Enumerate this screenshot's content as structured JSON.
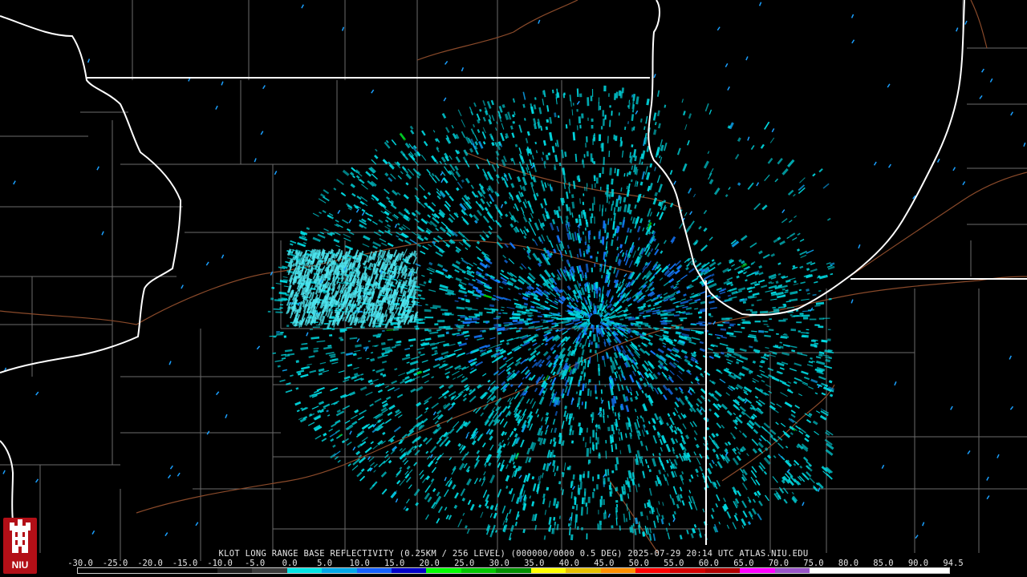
{
  "caption": "KLOT LONG RANGE BASE REFLECTIVITY (0.25KM / 256 LEVEL) (000000/0000 0.5 DEG) 2025-07-29 20:14 UTC  ATLAS.NIU.EDU",
  "logo_text": "NIU",
  "scale": {
    "labels": [
      "-30.0",
      "-25.0",
      "-20.0",
      "-15.0",
      "-10.0",
      "-5.0",
      "0.0",
      "5.0",
      "10.0",
      "15.0",
      "20.0",
      "25.0",
      "30.0",
      "35.0",
      "40.0",
      "45.0",
      "50.0",
      "55.0",
      "60.0",
      "65.0",
      "70.0",
      "75.0",
      "80.0",
      "85.0",
      "90.0",
      "94.5"
    ],
    "colors": [
      "#000000",
      "#000000",
      "#000000",
      "#000000",
      "#1e1e1e",
      "#3b3b3b",
      "#00e5e5",
      "#00a8e8",
      "#1460ff",
      "#0000c8",
      "#00ff00",
      "#00c800",
      "#009000",
      "#ffff00",
      "#e6c000",
      "#ff9000",
      "#ff0000",
      "#d40000",
      "#b00000",
      "#ff00ff",
      "#9955c9",
      "#ffffff",
      "#ffffff",
      "#ffffff",
      "#ffffff"
    ]
  },
  "colors": {
    "background": "#000000",
    "state_border": "#ffffff",
    "county_line": "#6b6b6b",
    "highway": "#8a4a2a",
    "echo_primary": "#00d8e0",
    "echo_strong": "#1478ff",
    "echo_green": "#00c800"
  },
  "radar_site": "KLOT"
}
